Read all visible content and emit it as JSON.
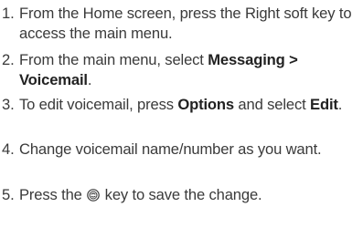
{
  "steps": [
    {
      "num": "1.",
      "text": "From the Home screen, press the Right soft key to access the main menu."
    },
    {
      "num": "2.",
      "pre": "From the main menu, select ",
      "bold": "Messaging > Voicemail",
      "post": "."
    },
    {
      "num": "3.",
      "pre": "To edit voicemail, press ",
      "bold1": "Options",
      "mid": " and select ",
      "bold2": "Edit",
      "post": "."
    },
    {
      "num": "4.",
      "text": "Change voicemail name/number as you want."
    },
    {
      "num": "5.",
      "pre": "Press the ",
      "icon": "ok-key-icon",
      "post": " key to save the change."
    }
  ]
}
